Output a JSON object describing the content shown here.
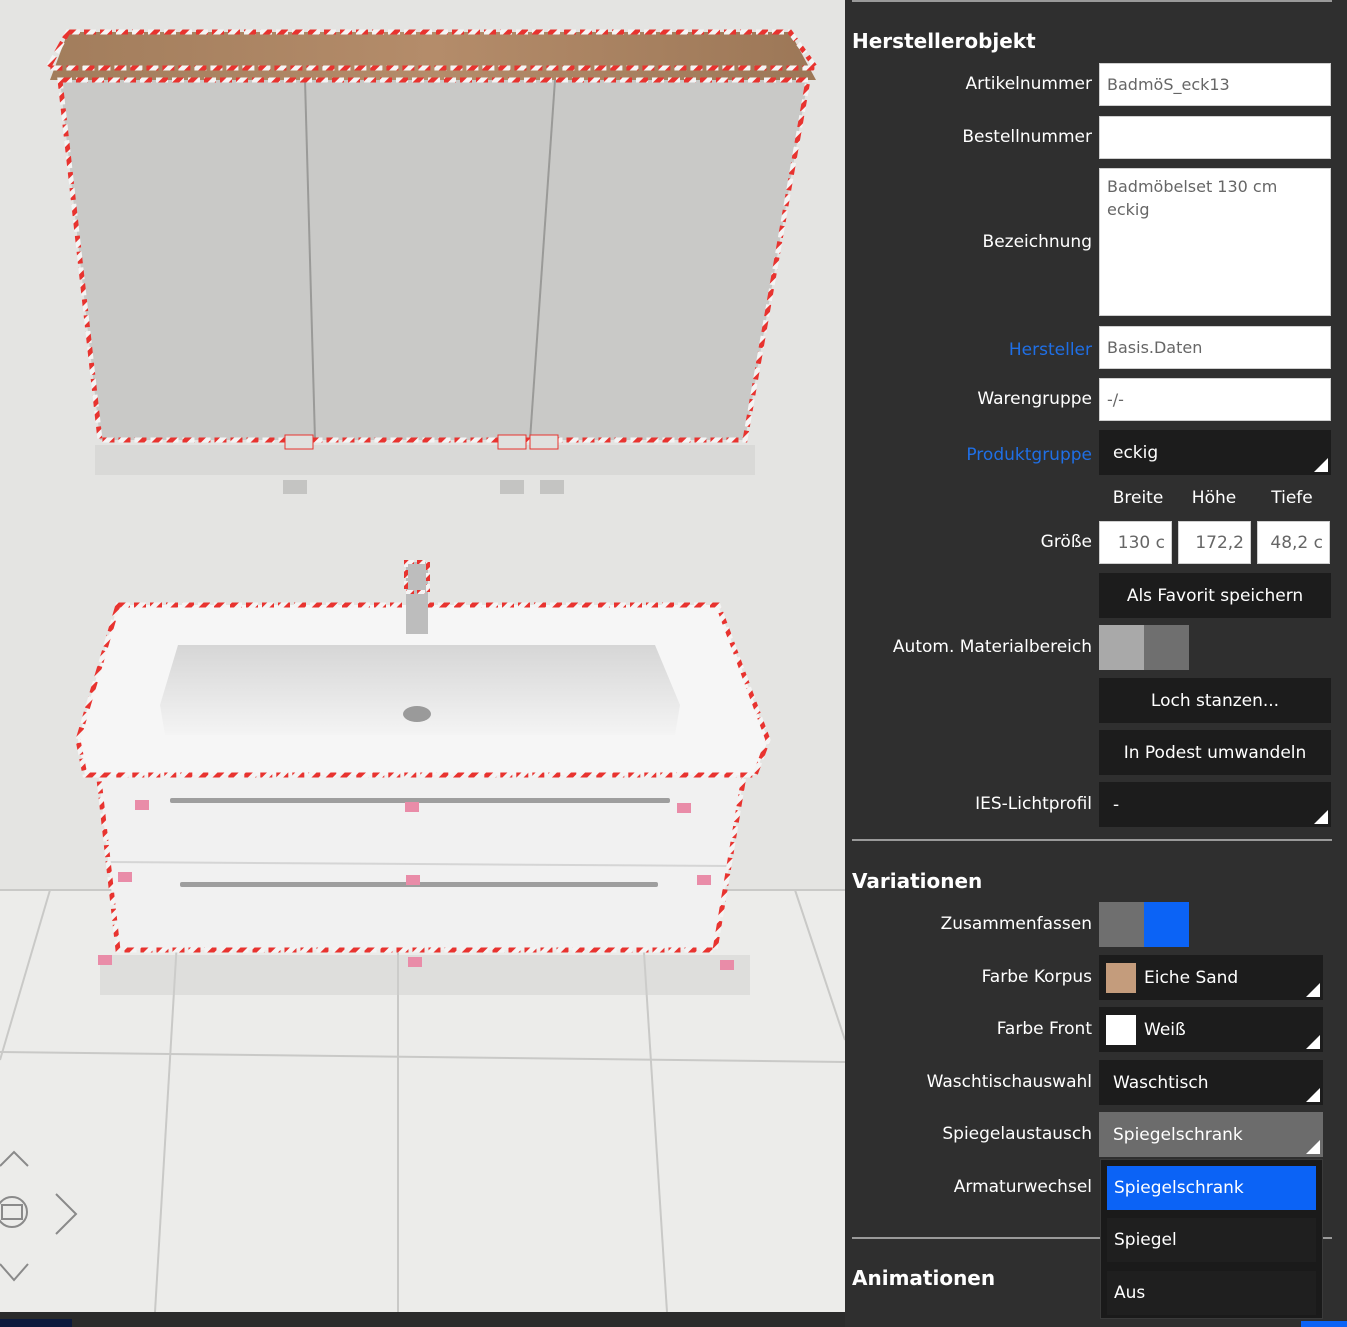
{
  "sections": {
    "manufacturer_object": "Herstellerobjekt",
    "variations": "Variationen",
    "animations": "Animationen"
  },
  "fields": {
    "article_number": {
      "label": "Artikelnummer",
      "value": "BadmöS_eck13"
    },
    "order_number": {
      "label": "Bestellnummer",
      "value": ""
    },
    "description": {
      "label": "Bezeichnung",
      "value": "Badmöbelset 130 cm eckig"
    },
    "manufacturer": {
      "label": "Hersteller",
      "value": "Basis.Daten"
    },
    "goods_group": {
      "label": "Warengruppe",
      "value": "-/-"
    },
    "product_group": {
      "label": "Produktgruppe",
      "value": "eckig"
    }
  },
  "size": {
    "label": "Größe",
    "width": {
      "label": "Breite",
      "value": "130 c"
    },
    "height": {
      "label": "Höhe",
      "value": "172,2"
    },
    "depth": {
      "label": "Tiefe",
      "value": "48,2 c"
    }
  },
  "buttons": {
    "save_favorite": "Als Favorit speichern",
    "punch_hole": "Loch stanzen...",
    "convert_podest": "In Podest umwandeln"
  },
  "auto_material": {
    "label": "Autom. Materialbereich"
  },
  "ies_profile": {
    "label": "IES-Lichtprofil",
    "value": "-"
  },
  "variations": {
    "combine": {
      "label": "Zusammenfassen"
    },
    "body_color": {
      "label": "Farbe Korpus",
      "value": "Eiche Sand",
      "swatch": "#c49c7c"
    },
    "front_color": {
      "label": "Farbe Front",
      "value": "Weiß",
      "swatch": "#ffffff"
    },
    "washbasin": {
      "label": "Waschtischauswahl",
      "value": "Waschtisch"
    },
    "mirror": {
      "label": "Spiegelaustausch",
      "value": "Spiegelschrank"
    },
    "fitting": {
      "label": "Armaturwechsel"
    }
  },
  "mirror_menu": {
    "options": [
      "Spiegelschrank",
      "Spiegel",
      "Aus"
    ],
    "selected": "Spiegelschrank"
  },
  "colors": {
    "accent": "#0b63f6",
    "link": "#1f6fe6",
    "selection_outline": "#e8332f"
  },
  "viewport_icons": [
    "chevron-up-icon",
    "camera-icon",
    "chevron-right-icon",
    "chevron-down-icon"
  ]
}
